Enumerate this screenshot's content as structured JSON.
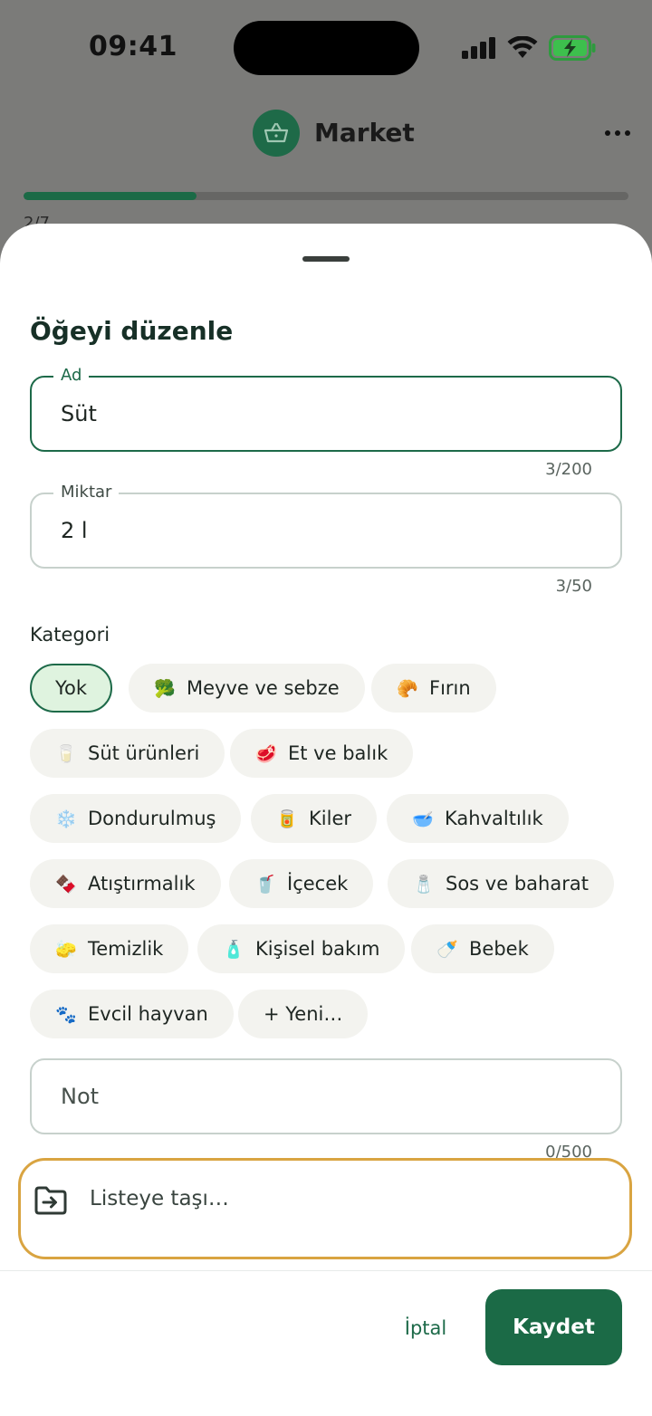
{
  "status_bar": {
    "time": "09:41"
  },
  "header": {
    "title": "Market",
    "icon": "basket-icon",
    "progress_fraction": 0.2857,
    "progress_text": "2/7"
  },
  "sheet": {
    "title": "Öğeyi düzenle",
    "name_field": {
      "label": "Ad",
      "value": "Süt",
      "counter": "3/200"
    },
    "quantity_field": {
      "label": "Miktar",
      "value": "2 l",
      "counter": "3/50"
    },
    "category_label": "Kategori",
    "categories": [
      {
        "label": "Yok",
        "emoji": "",
        "selected": true
      },
      {
        "label": "Meyve ve sebze",
        "emoji": "🥦"
      },
      {
        "label": "Fırın",
        "emoji": "🥐"
      },
      {
        "label": "Süt ürünleri",
        "emoji": "🥛"
      },
      {
        "label": "Et ve balık",
        "emoji": "🥩"
      },
      {
        "label": "Dondurulmuş",
        "emoji": "❄️"
      },
      {
        "label": "Kiler",
        "emoji": "🥫"
      },
      {
        "label": "Kahvaltılık",
        "emoji": "🥣"
      },
      {
        "label": "Atıştırmalık",
        "emoji": "🍫"
      },
      {
        "label": "İçecek",
        "emoji": "🥤"
      },
      {
        "label": "Sos ve baharat",
        "emoji": "🧂"
      },
      {
        "label": "Temizlik",
        "emoji": "🧽"
      },
      {
        "label": "Kişisel bakım",
        "emoji": "🧴"
      },
      {
        "label": "Bebek",
        "emoji": "🍼"
      },
      {
        "label": "Evcil hayvan",
        "emoji": "🐾"
      },
      {
        "label": "+ Yeni…",
        "emoji": ""
      }
    ],
    "note_field": {
      "placeholder": "Not",
      "counter": "0/500"
    },
    "move_button": {
      "label": "Listeye taşı…",
      "icon": "move-to-folder-icon"
    },
    "cancel_label": "İptal",
    "save_label": "Kaydet"
  },
  "colors": {
    "accent": "#1b6a46",
    "selected_chip_bg": "#dff3df",
    "focus_ring": "#d9a441"
  }
}
